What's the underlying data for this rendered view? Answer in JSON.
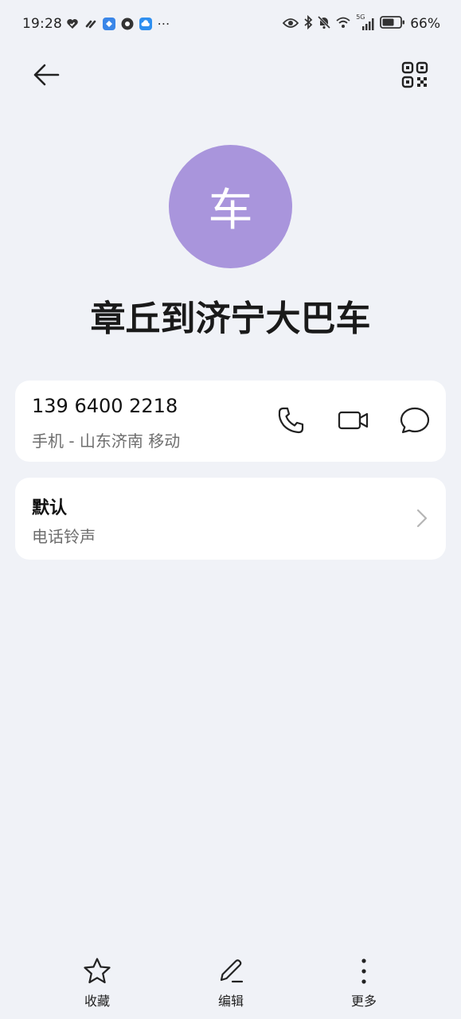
{
  "status_bar": {
    "time": "19:28",
    "battery_percent": "66%",
    "network": "5G",
    "left_icons": [
      "heart-shield-icon",
      "link-icon",
      "app-blue-icon",
      "chat-bubble-icon",
      "cloud-app-icon",
      "more-dots-icon"
    ],
    "right_icons": [
      "eye-icon",
      "bluetooth-icon",
      "mute-bell-icon",
      "wifi-icon",
      "signal-icon",
      "battery-icon"
    ]
  },
  "header": {
    "back_icon": "arrow-left-icon",
    "qr_icon": "qr-code-icon"
  },
  "contact": {
    "avatar_initial": "车",
    "avatar_color": "#a995dc",
    "name": "章丘到济宁大巴车"
  },
  "phone": {
    "number": "139 6400 2218",
    "label": "手机 - 山东济南 移动",
    "actions": [
      "phone-call-icon",
      "video-call-icon",
      "message-icon"
    ]
  },
  "ringtone": {
    "value": "默认",
    "label": "电话铃声"
  },
  "bottom_bar": {
    "favorite": "收藏",
    "edit": "编辑",
    "more": "更多"
  }
}
